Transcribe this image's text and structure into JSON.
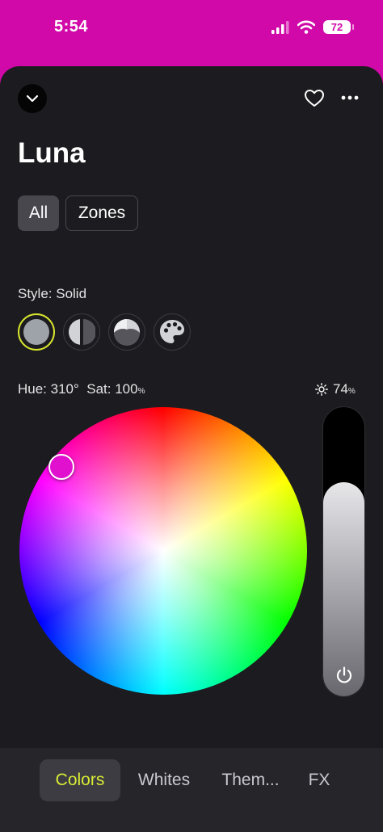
{
  "status_bar": {
    "time": "5:54",
    "battery": "72",
    "icons": [
      "cellular-signal-icon",
      "wifi-icon",
      "battery-icon"
    ]
  },
  "header": {
    "title": "Luna",
    "icons": [
      "chevron-down-icon",
      "heart-icon",
      "more-icon"
    ]
  },
  "segments": {
    "all_label": "All",
    "zones_label": "Zones",
    "selected": "All"
  },
  "style": {
    "label": "Style: Solid",
    "options": [
      "solid",
      "split",
      "gradient",
      "palette"
    ],
    "selected": "solid"
  },
  "color": {
    "hue_text": "Hue: 310°",
    "sat_text": "Sat: 100",
    "sat_unit": "%",
    "hue": 310,
    "saturation": 100
  },
  "brightness": {
    "value_text": "74",
    "unit": "%",
    "level": 0.74
  },
  "tabs": [
    {
      "label": "Colors",
      "active": true
    },
    {
      "label": "Whites",
      "active": false
    },
    {
      "label": "Them...",
      "active": false
    },
    {
      "label": "FX",
      "active": false
    }
  ],
  "colors": {
    "status_bar_bg": "#d109a8",
    "sheet_bg": "#1c1b1f",
    "accent": "#d8ec35",
    "selected_color": "#e10fce"
  }
}
